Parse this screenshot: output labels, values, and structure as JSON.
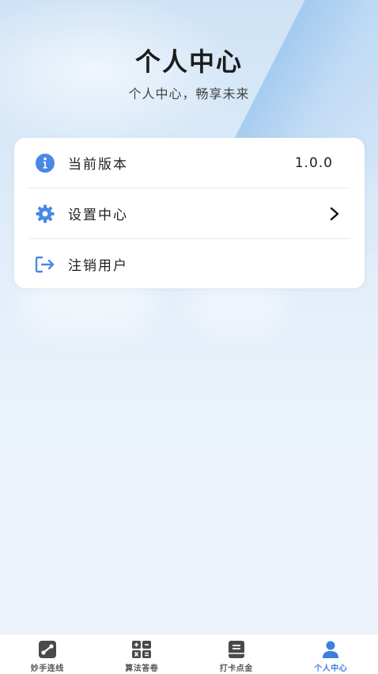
{
  "header": {
    "title": "个人中心",
    "subtitle": "个人中心，畅享未来"
  },
  "menu": {
    "items": [
      {
        "label": "当前版本",
        "value": "1.0.0",
        "icon": "info-icon"
      },
      {
        "label": "设置中心",
        "icon": "gear-icon",
        "trailing": "chevron-right-icon"
      },
      {
        "label": "注销用户",
        "icon": "logout-icon"
      }
    ]
  },
  "tabbar": {
    "tabs": [
      {
        "label": "妙手连线",
        "icon": "link-icon",
        "active": false
      },
      {
        "label": "算法答卷",
        "icon": "calculator-icon",
        "active": false
      },
      {
        "label": "打卡点金",
        "icon": "book-icon",
        "active": false
      },
      {
        "label": "个人中心",
        "icon": "person-icon",
        "active": true
      }
    ]
  },
  "colors": {
    "accent": "#3d7ee0",
    "icon_blue": "#4a88e6",
    "tab_icon": "#4a4a4a"
  }
}
